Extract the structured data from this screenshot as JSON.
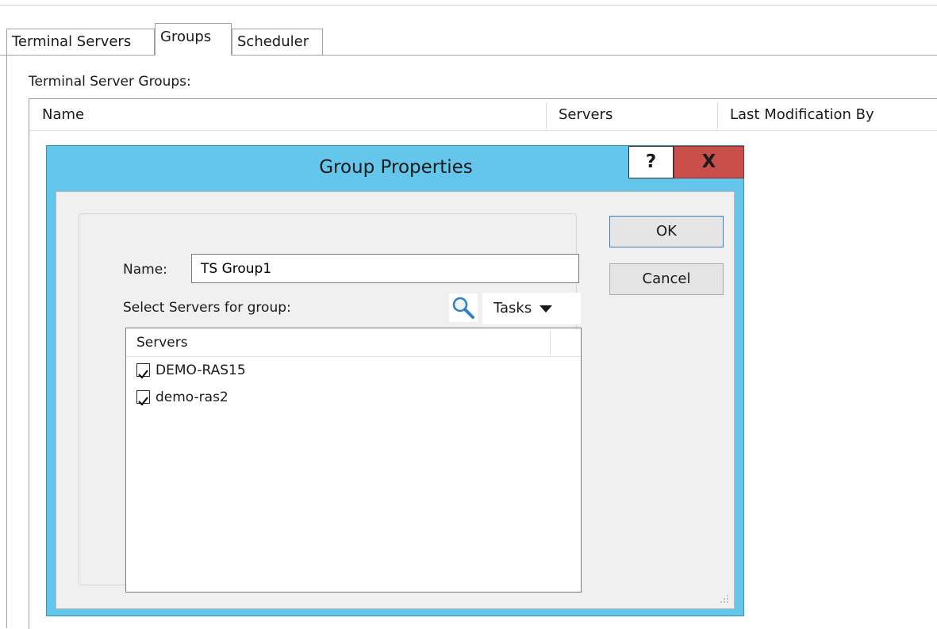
{
  "tabs": [
    {
      "label": "Terminal Servers"
    },
    {
      "label": "Groups"
    },
    {
      "label": "Scheduler"
    }
  ],
  "groups_section": {
    "label": "Terminal Server Groups:",
    "columns": [
      "Name",
      "Servers",
      "Last Modification By"
    ]
  },
  "dialog": {
    "title": "Group Properties",
    "help_label": "?",
    "close_label": "X",
    "name_label": "Name:",
    "name_value": "TS Group1",
    "select_label": "Select Servers for group:",
    "tasks_label": "Tasks",
    "servers_header": "Servers",
    "servers": [
      {
        "name": "DEMO-RAS15",
        "checked": true
      },
      {
        "name": "demo-ras2",
        "checked": true
      }
    ],
    "ok_label": "OK",
    "cancel_label": "Cancel"
  },
  "colors": {
    "dialog_frame": "#63c6ea",
    "close_button": "#c9504a",
    "body_bg": "#f0f0f0"
  }
}
